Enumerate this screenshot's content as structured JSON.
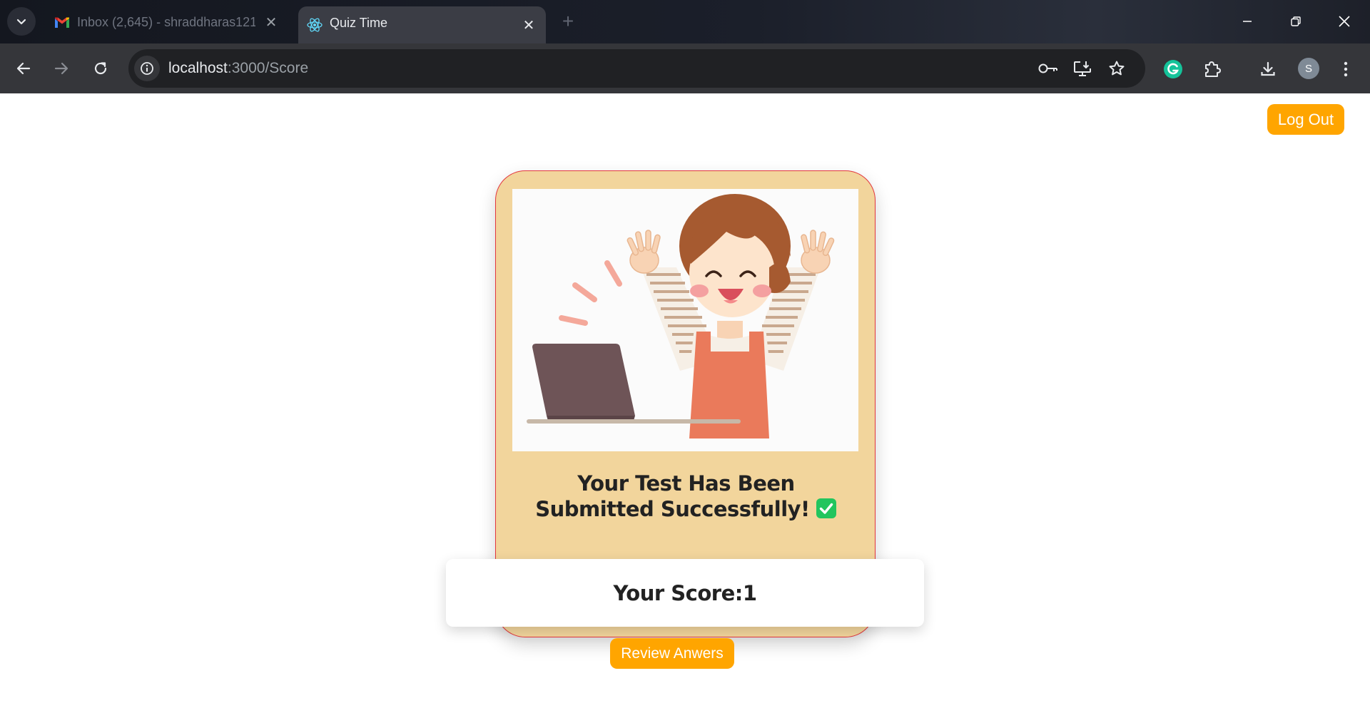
{
  "browser": {
    "tabs": [
      {
        "title": "Inbox (2,645) - shraddharas121",
        "active": false,
        "favicon": "gmail-icon"
      },
      {
        "title": "Quiz Time",
        "active": true,
        "favicon": "react-icon"
      }
    ],
    "url_host": "localhost",
    "url_path": ":3000/Score",
    "profile_initial": "S"
  },
  "page": {
    "logout_label": "Log Out",
    "result_message": "Your Test Has Been Submitted Successfully!",
    "score_label": "Your Score:",
    "score_value": "1",
    "review_label": "Review Anwers"
  },
  "colors": {
    "accent_orange": "#ffa500",
    "card_background": "#f2d59c",
    "card_border": "#e2363d",
    "check_green": "#22c55e"
  }
}
